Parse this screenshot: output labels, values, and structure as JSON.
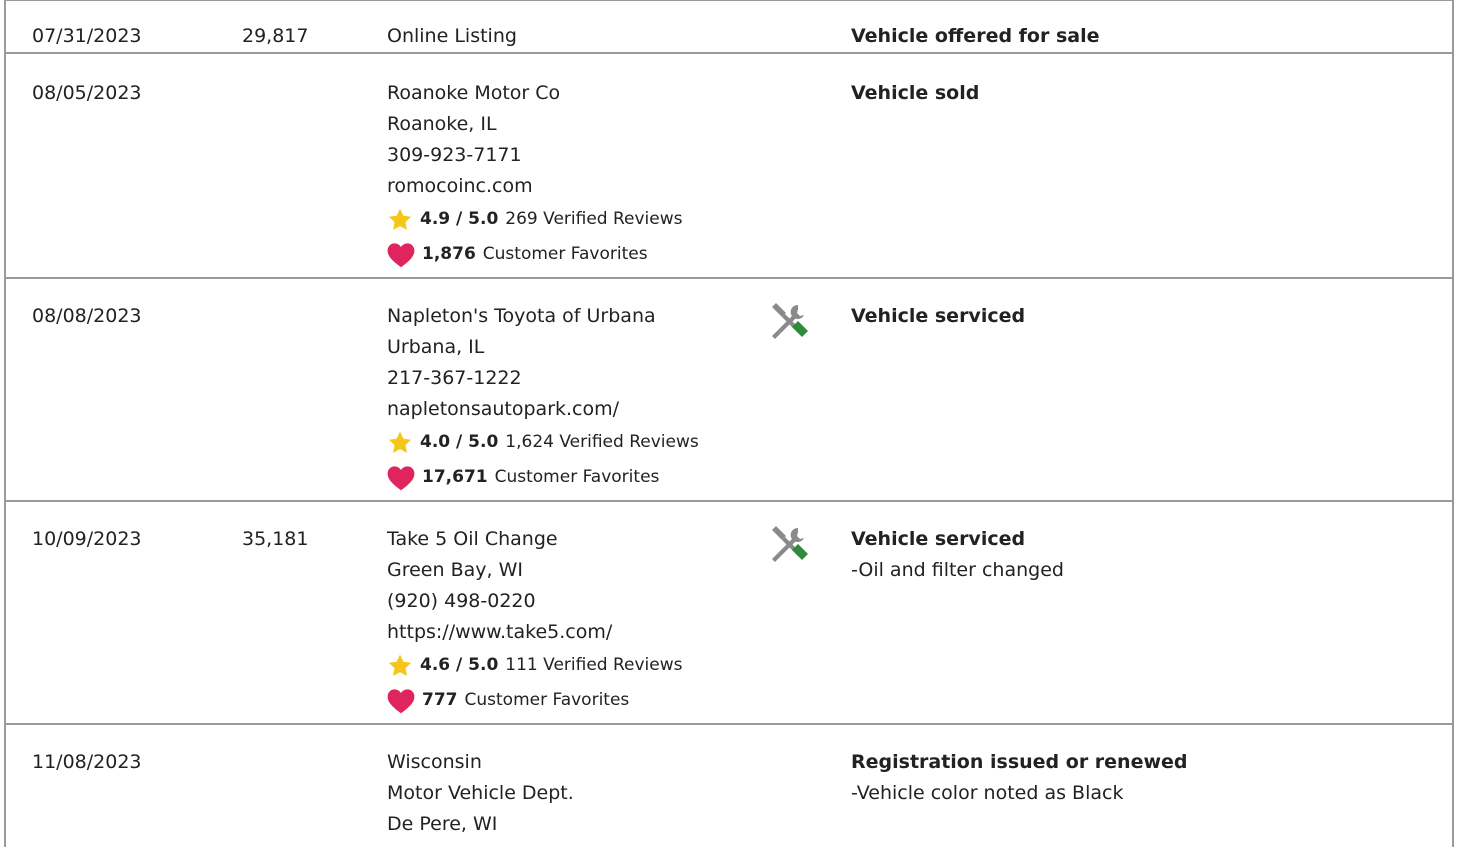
{
  "records": [
    {
      "date": "07/31/2023",
      "mileage": "29,817",
      "source": {
        "lines": [
          "Online Listing"
        ]
      },
      "detail": {
        "title": "Vehicle offered for sale",
        "notes": []
      }
    },
    {
      "date": "08/05/2023",
      "mileage": "",
      "source": {
        "lines": [
          "Roanoke Motor Co",
          "Roanoke, IL",
          "309-923-7171",
          "romocoinc.com"
        ],
        "rating": "4.9 / 5.0",
        "reviews": "269 Verified Reviews",
        "favorites": "1,876",
        "favorites_label": "Customer Favorites"
      },
      "detail": {
        "title": "Vehicle sold",
        "notes": []
      }
    },
    {
      "date": "08/08/2023",
      "mileage": "",
      "source": {
        "lines": [
          "Napleton's Toyota of Urbana",
          "Urbana, IL",
          "217-367-1222",
          "napletonsautopark.com/"
        ],
        "rating": "4.0 / 5.0",
        "reviews": "1,624 Verified Reviews",
        "favorites": "17,671",
        "favorites_label": "Customer Favorites"
      },
      "icon": "service-tools-icon",
      "detail": {
        "title": "Vehicle serviced",
        "notes": []
      }
    },
    {
      "date": "10/09/2023",
      "mileage": "35,181",
      "source": {
        "lines": [
          "Take 5 Oil Change",
          "Green Bay, WI",
          "(920) 498-0220",
          "https://www.take5.com/"
        ],
        "rating": "4.6 / 5.0",
        "reviews": "111 Verified Reviews",
        "favorites": "777",
        "favorites_label": "Customer Favorites"
      },
      "icon": "service-tools-icon",
      "detail": {
        "title": "Vehicle serviced",
        "notes": [
          "-Oil and filter changed"
        ]
      }
    },
    {
      "date": "11/08/2023",
      "mileage": "",
      "source": {
        "lines": [
          "Wisconsin",
          "Motor Vehicle Dept.",
          "De Pere, WI"
        ]
      },
      "detail": {
        "title": "Registration issued or renewed",
        "notes": [
          "-Vehicle color noted as Black"
        ]
      }
    }
  ],
  "colors": {
    "border": "#9a9a9a",
    "star": "#f5c518",
    "heart": "#e0245e",
    "wrench_gray": "#8a8a8a",
    "screwdriver_green": "#2e8b3a"
  }
}
